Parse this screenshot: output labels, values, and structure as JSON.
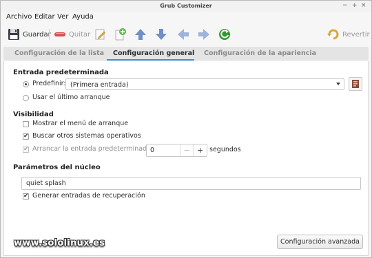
{
  "window": {
    "title": "Grub Customizer",
    "controls": [
      "−",
      "+",
      "×"
    ]
  },
  "menubar": {
    "items": [
      "Archivo",
      "Editar",
      "Ver",
      "Ayuda"
    ]
  },
  "toolbar": {
    "save_label": "Guardar",
    "remove_label": "Quitar",
    "revert_label": "Revertir",
    "icons": [
      "save-icon",
      "remove-icon",
      "edit-icon",
      "add-icon",
      "move-up-icon",
      "move-down-icon",
      "move-left-icon",
      "move-right-icon",
      "refresh-icon",
      "revert-icon"
    ],
    "colors": {
      "arrow": "#6f8fc6",
      "refresh": "#2e9a2e",
      "remove": "#d94a4a"
    }
  },
  "tabs": [
    {
      "label": "Configuración de la lista",
      "active": false
    },
    {
      "label": "Configuración general",
      "active": true
    },
    {
      "label": "Configuración de la apariencia",
      "active": false
    }
  ],
  "default_entry": {
    "heading": "Entrada predeterminada",
    "predefine_label": "Predefinir:",
    "predefine_value": "(Primera entrada)",
    "last_boot_label": "Usar el último arranque"
  },
  "visibility": {
    "heading": "Visibilidad",
    "show_menu_label": "Mostrar el menú de arranque",
    "show_menu_checked": false,
    "search_os_label": "Buscar otros sistemas operativos",
    "search_os_checked": true,
    "boot_default_label": "Arrancar la entrada predeterminada en",
    "boot_default_checked": true,
    "timeout_value": "0",
    "timeout_unit": "segundos",
    "minus": "−",
    "plus": "+"
  },
  "kernel": {
    "heading": "Parámetros del núcleo",
    "params_value": "quiet splash",
    "recovery_label": "Generar entradas de recuperación",
    "recovery_checked": true
  },
  "advanced_button": "Configuración avanzada",
  "watermark": "www.sololinux.es",
  "accent_color": "#3d8fd1"
}
